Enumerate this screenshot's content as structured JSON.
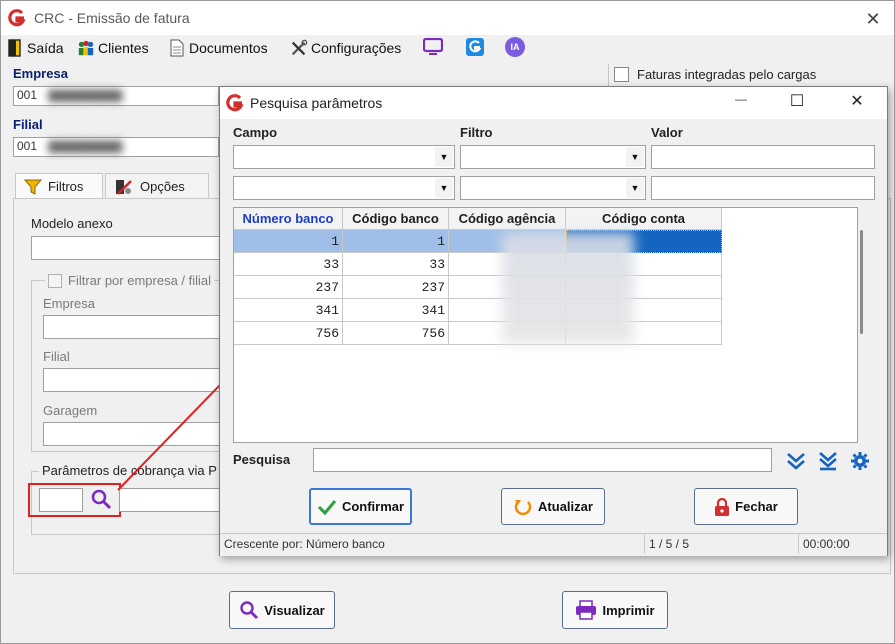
{
  "window": {
    "title": "CRC - Emissão de fatura",
    "close_glyph": "✕"
  },
  "menu": [
    {
      "label": "Saída",
      "icon": "exit-door-icon"
    },
    {
      "label": "Clientes",
      "icon": "clients-icon"
    },
    {
      "label": "Documentos",
      "icon": "document-icon"
    },
    {
      "label": "Configurações",
      "icon": "tools-icon"
    }
  ],
  "menu_extra_icons": [
    "monitor-icon",
    "g-app-icon",
    "ia-icon"
  ],
  "ia_label": "IA",
  "form": {
    "empresa_label": "Empresa",
    "empresa_value": "001",
    "filial_label": "Filial",
    "filial_value": "001",
    "faturas_checkbox_label": "Faturas integradas pelo cargas",
    "faturas_checked": false
  },
  "tabs": [
    {
      "label": "Filtros",
      "icon": "funnel-icon"
    },
    {
      "label": "Opções",
      "icon": "options-tools-icon"
    }
  ],
  "panel": {
    "modelo_anexo_label": "Modelo anexo",
    "filtrar_label": "Filtrar por empresa / filial",
    "empresa_label": "Empresa",
    "filial_label": "Filial",
    "garagem_label": "Garagem",
    "parametros_label": "Parâmetros de cobrança via P"
  },
  "bottom_buttons": {
    "visualizar": "Visualizar",
    "imprimir": "Imprimir"
  },
  "dialog": {
    "title": "Pesquisa parâmetros",
    "min_glyph": "—",
    "max_glyph": "☐",
    "close_glyph": "✕",
    "campo_label": "Campo",
    "filtro_label": "Filtro",
    "valor_label": "Valor",
    "columns": [
      "Número banco",
      "Código banco",
      "Código agência",
      "Código conta"
    ],
    "rows": [
      {
        "numero_banco": "1",
        "codigo_banco": "1"
      },
      {
        "numero_banco": "33",
        "codigo_banco": "33"
      },
      {
        "numero_banco": "237",
        "codigo_banco": "237"
      },
      {
        "numero_banco": "341",
        "codigo_banco": "341"
      },
      {
        "numero_banco": "756",
        "codigo_banco": "756"
      }
    ],
    "pesquisa_label": "Pesquisa",
    "confirmar_label": "Confirmar",
    "atualizar_label": "Atualizar",
    "fechar_label": "Fechar",
    "status_sort": "Crescente por: Número banco",
    "status_count": "1 / 5 / 5",
    "status_time": "00:00:00"
  },
  "colors": {
    "accent_blue": "#1565c0",
    "highlight_red": "#e02020",
    "selected_row": "#9fbfe8",
    "purple_icon": "#7b2cbf"
  }
}
